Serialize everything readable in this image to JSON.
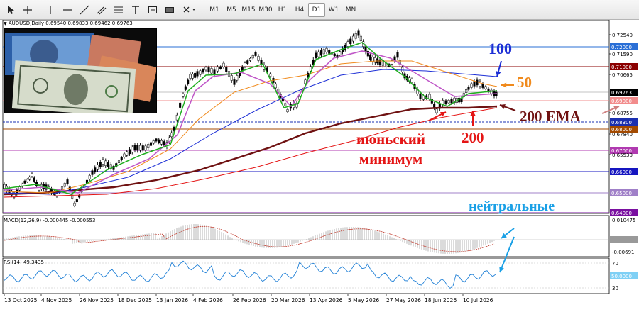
{
  "toolbar": {
    "timeframes": [
      "M1",
      "M5",
      "M15",
      "M30",
      "H1",
      "H4",
      "D1",
      "W1",
      "MN"
    ],
    "active_timeframe": "D1"
  },
  "chart": {
    "symbol_header": "AUDUSD,Daily  0.69540 0.69833 0.69462 0.69763",
    "price_axis": [
      "0.72540",
      "0.71590",
      "0.70665",
      "0.68755",
      "0.67840",
      "0.65530"
    ],
    "level_labels": [
      {
        "text": "0.72000",
        "color": "#2a6fd6"
      },
      {
        "text": "0.71000",
        "color": "#8b0000"
      },
      {
        "text": "0.69000",
        "color": "#f28c8c"
      },
      {
        "text": "0.68300",
        "color": "#1a2fb0"
      },
      {
        "text": "0.68000",
        "color": "#a34a00"
      },
      {
        "text": "0.67000",
        "color": "#b03ab0"
      },
      {
        "text": "0.66000",
        "color": "#1515c0"
      },
      {
        "text": "0.65000",
        "color": "#a080c8"
      },
      {
        "text": "0.64000",
        "color": "#7a10a0"
      }
    ],
    "current_price": "0.69763",
    "x_axis": [
      "13 Oct 2025",
      "4 Nov 2025",
      "26 Nov 2025",
      "18 Dec 2025",
      "13 Jan 2026",
      "4 Feb 2026",
      "26 Feb 2026",
      "20 Mar 2026",
      "13 Apr 2026",
      "5 May 2026",
      "27 May 2026",
      "18 Jun 2026",
      "10 Jul 2026"
    ]
  },
  "annotations": {
    "ma100": "100",
    "ma50": "50",
    "ema200": "200 EMA",
    "ma200": "200",
    "june_low_line1": "июньский",
    "june_low_line2": "минимум",
    "neutral": "нейтральные"
  },
  "macd": {
    "label": "MACD(12,26,9) -0.000445 -0.000553",
    "scale": [
      "0.010475",
      "0.000000",
      "-0.00691"
    ]
  },
  "rsi": {
    "label": "RSI(14) 49.3435",
    "scale": [
      "70",
      "50.0000",
      "30"
    ],
    "value": 49.3435
  },
  "colors": {
    "ma100": "#1d2fd6",
    "ma50": "#f08a1c",
    "ema200": "#6f1212",
    "ma200": "#e41515",
    "neutral": "#1aa0e6",
    "green_ma": "#1fae1f",
    "violet_ma": "#c058c8"
  }
}
